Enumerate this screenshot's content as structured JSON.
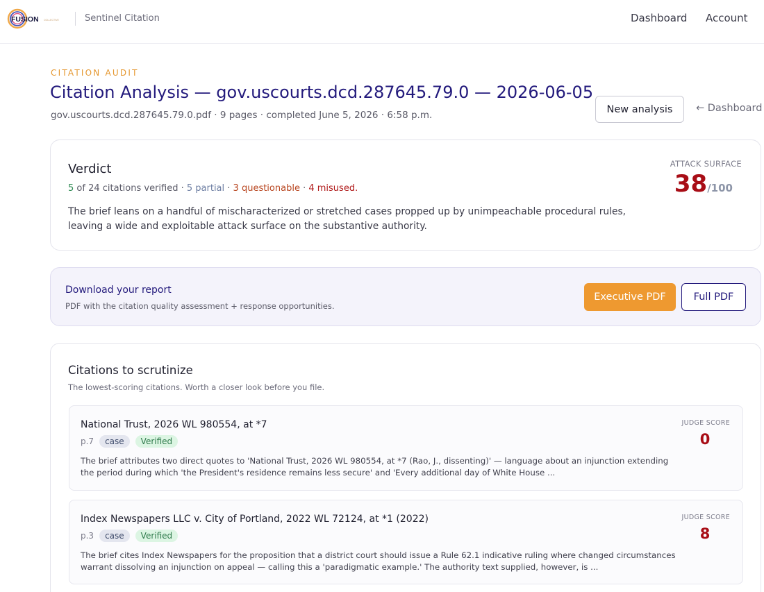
{
  "topbar": {
    "logo_text": "FUSION",
    "logo_subtext": "COLLECTIVE",
    "product_name": "Sentinel Citation",
    "nav": [
      {
        "label": "Dashboard"
      },
      {
        "label": "Account"
      }
    ]
  },
  "header": {
    "eyebrow": "CITATION AUDIT",
    "title": "Citation Analysis — gov.uscourts.dcd.287645.79.0 — 2026-06-05",
    "meta": "gov.uscourts.dcd.287645.79.0.pdf · 9 pages · completed June 5, 2026 · 6:58 p.m.",
    "new_analysis_label": "New analysis",
    "back_label": "← Dashboard"
  },
  "verdict": {
    "title": "Verdict",
    "verified_count": "5",
    "of_text": " of ",
    "total_count": "24",
    "verified_suffix": " citations verified · ",
    "partial": "5 partial",
    "sep1": " · ",
    "questionable": "3 questionable",
    "sep2": " · ",
    "misused": "4 misused.",
    "summary": "The brief leans on a handful of mischaracterized or stretched cases propped up by unimpeachable procedural rules, leaving a wide and exploitable attack surface on the substantive authority.",
    "attack_surface_label": "ATTACK SURFACE",
    "attack_surface_score": "38",
    "attack_surface_max": "/100"
  },
  "download": {
    "title": "Download your report",
    "subtitle": "PDF with the citation quality assessment + response opportunities.",
    "executive_label": "Executive PDF",
    "full_label": "Full PDF"
  },
  "scrutinize": {
    "title": "Citations to scrutinize",
    "subtitle": "The lowest-scoring citations. Worth a closer look before you file.",
    "items": [
      {
        "name": "National Trust, 2026 WL 980554, at *7",
        "page": "p.7",
        "type": "case",
        "status": "Verified",
        "description": "The brief attributes two direct quotes to 'National Trust, 2026 WL 980554, at *7 (Rao, J., dissenting)' — language about an injunction extending the period during which 'the President's residence remains less secure' and 'Every additional day of White House ...",
        "score_label": "JUDGE SCORE",
        "score": "0"
      },
      {
        "name": "Index Newspapers LLC v. City of Portland, 2022 WL 72124, at *1 (2022)",
        "page": "p.3",
        "type": "case",
        "status": "Verified",
        "description": "The brief cites Index Newspapers for the proposition that a district court should issue a Rule 62.1 indicative ruling where changed circumstances warrant dissolving an injunction on appeal — calling this a 'paradigmatic example.' The authority text supplied, however, is ...",
        "score_label": "JUDGE SCORE",
        "score": "8"
      }
    ]
  },
  "colors": {
    "brand_navy": "#231a7c",
    "accent_orange": "#ee9930",
    "score_red": "#a80d16",
    "verified_green": "#2e8a52"
  }
}
